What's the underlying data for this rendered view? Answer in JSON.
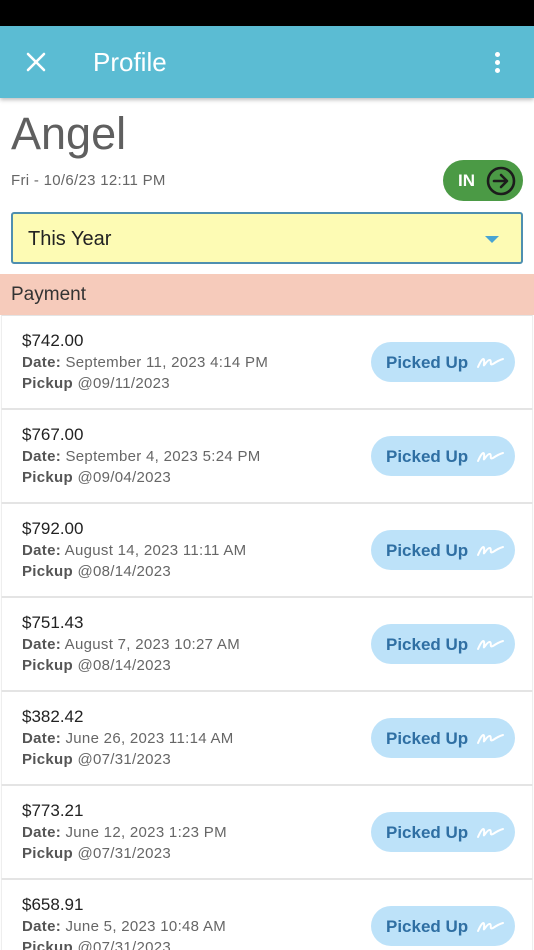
{
  "header": {
    "title": "Profile",
    "close_icon": "close-icon",
    "menu_icon": "more-vertical-icon",
    "color": "#5bbcd3"
  },
  "profile": {
    "name": "Angel",
    "datetime": "Fri - 10/6/23 12:11 PM",
    "status_label": "IN",
    "status_icon": "arrow-right-circle-icon",
    "status_color": "#4b9a45"
  },
  "filter": {
    "selected": "This Year",
    "background": "#fdfbb4"
  },
  "section": {
    "title": "Payment",
    "background": "#f6cbbb"
  },
  "labels": {
    "date": "Date:",
    "pickup": "Pickup",
    "at": "@"
  },
  "payments": [
    {
      "amount": "$742.00",
      "date": "September 11, 2023 4:14 PM",
      "pickup": "09/11/2023",
      "status": "Picked Up"
    },
    {
      "amount": "$767.00",
      "date": "September 4, 2023 5:24 PM",
      "pickup": "09/04/2023",
      "status": "Picked Up"
    },
    {
      "amount": "$792.00",
      "date": "August 14, 2023 11:11 AM",
      "pickup": "08/14/2023",
      "status": "Picked Up"
    },
    {
      "amount": "$751.43",
      "date": "August 7, 2023 10:27 AM",
      "pickup": "08/14/2023",
      "status": "Picked Up"
    },
    {
      "amount": "$382.42",
      "date": "June 26, 2023 11:14 AM",
      "pickup": "07/31/2023",
      "status": "Picked Up"
    },
    {
      "amount": "$773.21",
      "date": "June 12, 2023 1:23 PM",
      "pickup": "07/31/2023",
      "status": "Picked Up"
    },
    {
      "amount": "$658.91",
      "date": "June 5, 2023 10:48 AM",
      "pickup": "07/31/2023",
      "status": "Picked Up"
    }
  ]
}
